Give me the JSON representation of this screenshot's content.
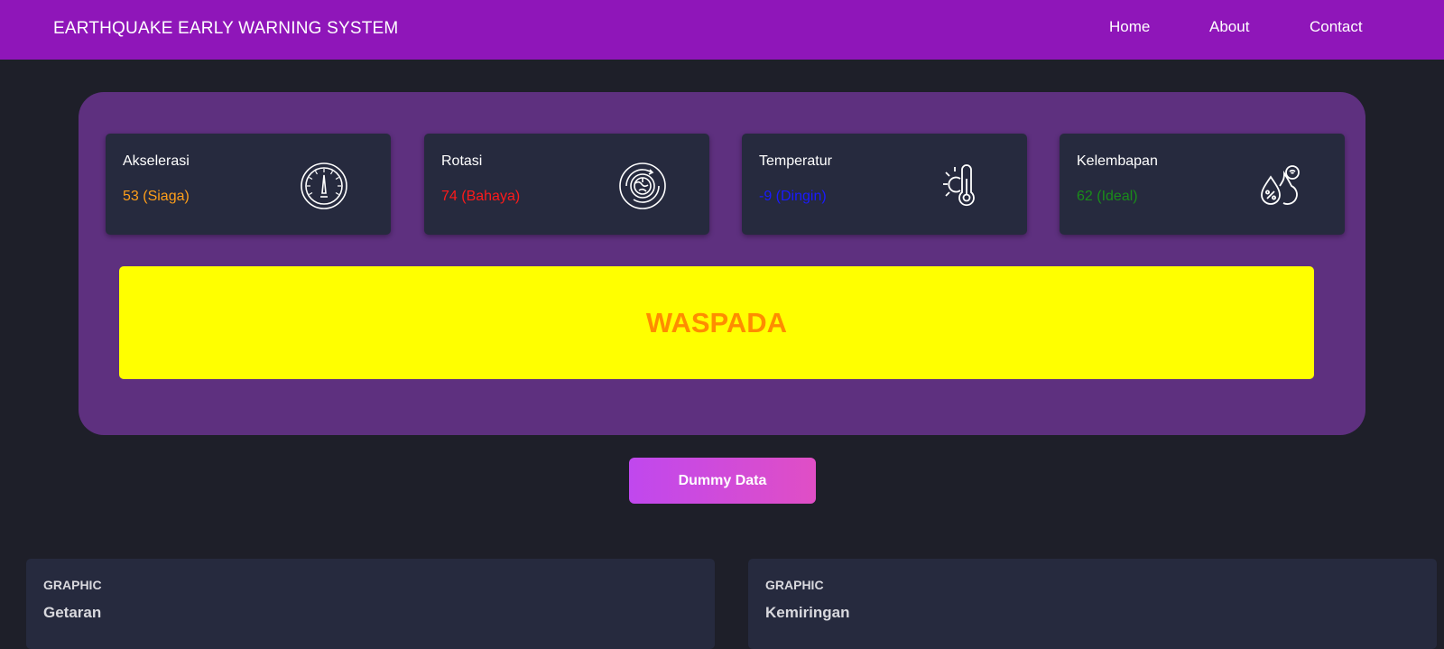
{
  "navbar": {
    "brand": "EARTHQUAKE EARLY WARNING SYSTEM",
    "links": [
      "Home",
      "About",
      "Contact"
    ]
  },
  "cards": [
    {
      "label": "Akselerasi",
      "value": "53 (Siaga)",
      "value_color": "#ff9f1a",
      "icon": "speedometer-icon"
    },
    {
      "label": "Rotasi",
      "value": "74 (Bahaya)",
      "value_color": "#ff1a1a",
      "icon": "rotation-icon"
    },
    {
      "label": "Temperatur",
      "value": "-9 (Dingin)",
      "value_color": "#1a1aff",
      "icon": "thermometer-sun-icon"
    },
    {
      "label": "Kelembapan",
      "value": "62 (Ideal)",
      "value_color": "#1a8c1a",
      "icon": "humidity-drops-icon"
    }
  ],
  "alert": {
    "text": "WASPADA",
    "background": "#ffff00",
    "text_color": "#ff8c00"
  },
  "dummy_button": {
    "label": "Dummy Data"
  },
  "graphs": [
    {
      "kicker": "GRAPHIC",
      "title": "Getaran"
    },
    {
      "kicker": "GRAPHIC",
      "title": "Kemiringan"
    }
  ],
  "colors": {
    "navbar": "#8f16b9",
    "panel": "#5e307f",
    "card": "#262a3e",
    "page_bg": "#1e1f29"
  }
}
